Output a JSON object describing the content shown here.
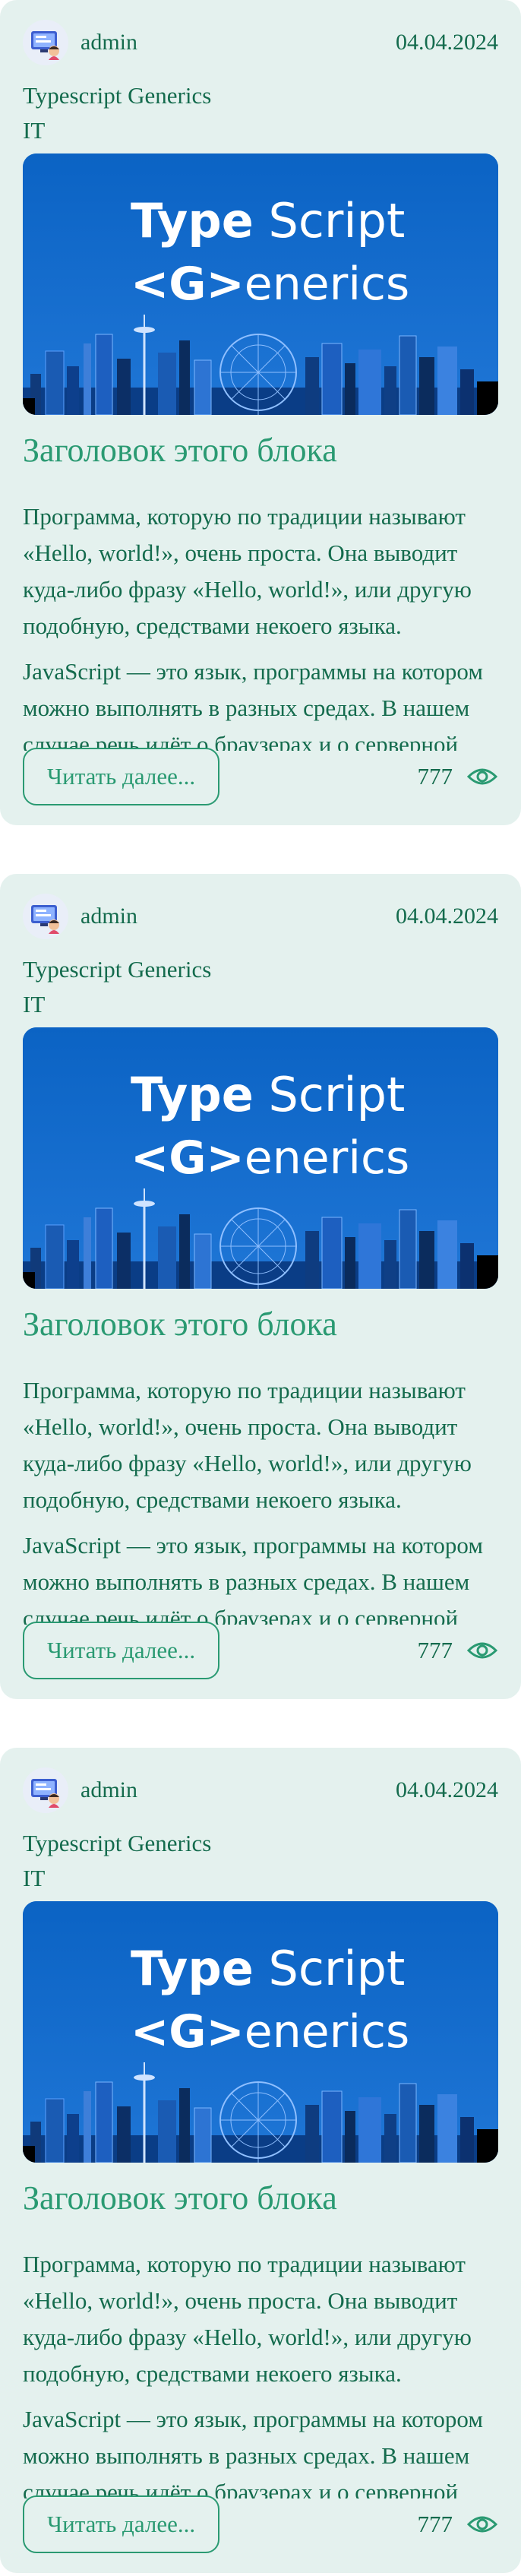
{
  "posts": [
    {
      "author": "admin",
      "date": "04.04.2024",
      "subtitle": "Typescript Generics",
      "category": "IT",
      "cover": {
        "line1_bold": "Type",
        "line1_light": " Script",
        "line2_bold": "<G>",
        "line2_light": "enerics"
      },
      "title": "Заголовок этого блока",
      "excerpt": [
        "Программа, которую по традиции называют «Hello, world!», очень проста. Она выводит куда-либо фразу «Hello, world!», или другую подобную, средствами некоего языка.",
        "JavaScript — это язык, программы на котором можно выполнять в разных средах. В нашем случае речь идёт о браузерах и о серверной платформе Node.js."
      ],
      "read_more_label": "Читать далее...",
      "views": "777"
    },
    {
      "author": "admin",
      "date": "04.04.2024",
      "subtitle": "Typescript Generics",
      "category": "IT",
      "cover": {
        "line1_bold": "Type",
        "line1_light": " Script",
        "line2_bold": "<G>",
        "line2_light": "enerics"
      },
      "title": "Заголовок этого блока",
      "excerpt": [
        "Программа, которую по традиции называют «Hello, world!», очень проста. Она выводит куда-либо фразу «Hello, world!», или другую подобную, средствами некоего языка.",
        "JavaScript — это язык, программы на котором можно выполнять в разных средах. В нашем случае речь идёт о браузерах и о серверной платформе Node.js."
      ],
      "read_more_label": "Читать далее...",
      "views": "777"
    },
    {
      "author": "admin",
      "date": "04.04.2024",
      "subtitle": "Typescript Generics",
      "category": "IT",
      "cover": {
        "line1_bold": "Type",
        "line1_light": " Script",
        "line2_bold": "<G>",
        "line2_light": "enerics"
      },
      "title": "Заголовок этого блока",
      "excerpt": [
        "Программа, которую по традиции называют «Hello, world!», очень проста. Она выводит куда-либо фразу «Hello, world!», или другую подобную, средствами некоего языка.",
        "JavaScript — это язык, программы на котором можно выполнять в разных средах. В нашем случае речь идёт о браузерах и о серверной платформе Node.js."
      ],
      "read_more_label": "Читать далее...",
      "views": "777"
    }
  ],
  "colors": {
    "card_bg": "#e4f1ee",
    "text": "#146b4d",
    "accent": "#2a9a72",
    "cover_bg": "#0b63c4"
  },
  "icons": {
    "avatar": "avatar-icon",
    "views": "eye-icon"
  }
}
